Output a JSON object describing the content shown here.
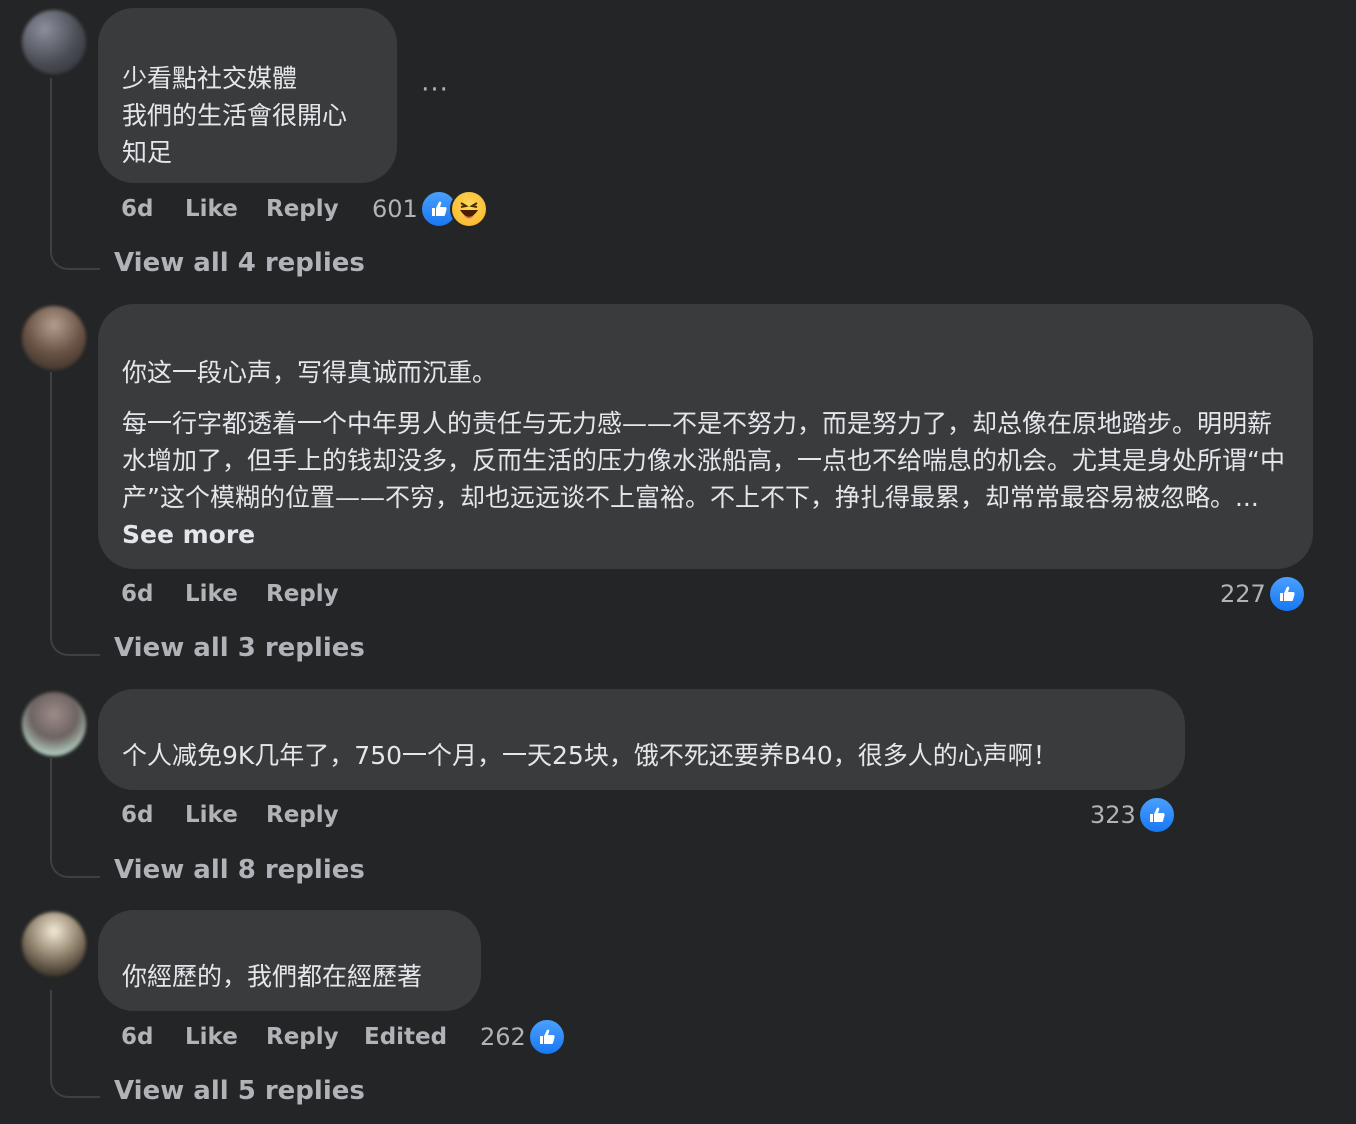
{
  "comments": [
    {
      "text": "少看點社交媒體\n我們的生活會很開心\n知足",
      "time": "6d",
      "like_label": "Like",
      "reply_label": "Reply",
      "reaction_count": "601",
      "reactions": [
        "like-icon",
        "haha-icon"
      ],
      "view_replies": "View all 4 replies"
    },
    {
      "paragraphs": [
        "你这一段心声，写得真诚而沉重。",
        "每一行字都透着一个中年男人的责任与无力感——不是不努力，而是努力了，却总像在原地踏步。明明薪水增加了，但手上的钱却没多，反而生活的压力像水涨船高，一点也不给喘息的机会。尤其是身处所谓“中产”这个模糊的位置——不穷，却也远远谈不上富裕。不上不下，挣扎得最累，却常常最容易被忽略。... "
      ],
      "see_more": "See more",
      "time": "6d",
      "like_label": "Like",
      "reply_label": "Reply",
      "reaction_count": "227",
      "reactions": [
        "like-icon"
      ],
      "view_replies": "View all 3 replies"
    },
    {
      "text": "个人减免9K几年了，750一个月，一天25块，饿不死还要养B40，很多人的心声啊！",
      "time": "6d",
      "like_label": "Like",
      "reply_label": "Reply",
      "reaction_count": "323",
      "reactions": [
        "like-icon"
      ],
      "view_replies": "View all 8 replies"
    },
    {
      "text": "你經歷的，我們都在經歷著",
      "time": "6d",
      "like_label": "Like",
      "reply_label": "Reply",
      "edited_label": "Edited",
      "reaction_count": "262",
      "reactions": [
        "like-icon"
      ],
      "view_replies": "View all 5 replies"
    }
  ],
  "more_options_icon": "more-horizontal-icon",
  "colors": {
    "background": "#242526",
    "bubble": "#3a3b3c",
    "text": "#e4e6eb",
    "secondary": "#b0b3b8",
    "like_blue": "#1877f2"
  }
}
